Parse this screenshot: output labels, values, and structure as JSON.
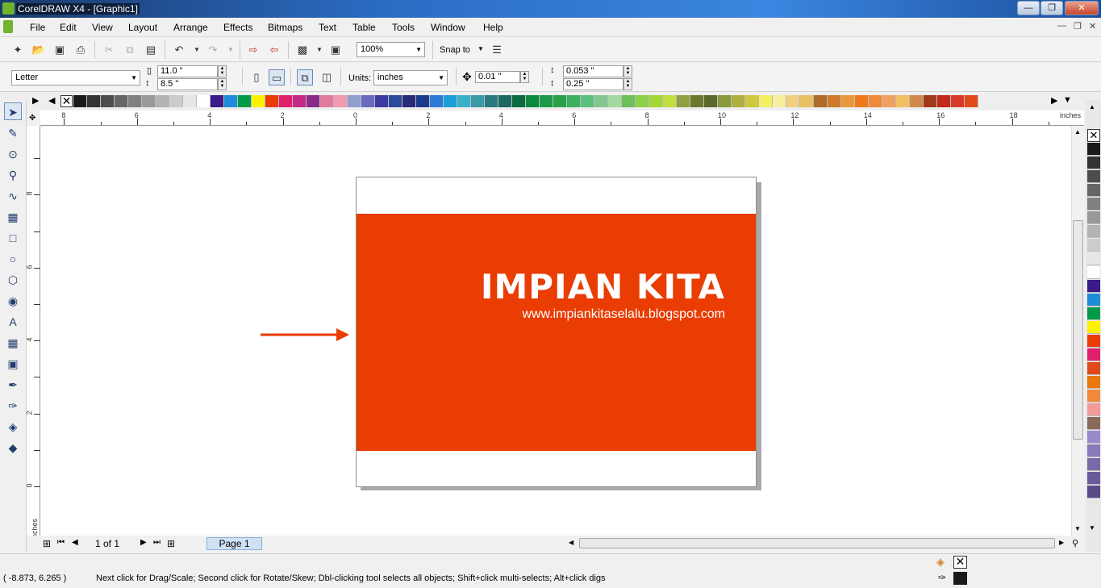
{
  "window": {
    "title": "CorelDRAW X4 - [Graphic1]"
  },
  "menu": [
    "File",
    "Edit",
    "View",
    "Layout",
    "Arrange",
    "Effects",
    "Bitmaps",
    "Text",
    "Table",
    "Tools",
    "Window",
    "Help"
  ],
  "toolbar": {
    "zoom": "100%",
    "snap_to": "Snap to"
  },
  "property_bar": {
    "paper_size": "Letter",
    "width": "11.0 \"",
    "height": "8.5 \"",
    "units_label": "Units:",
    "units": "inches",
    "nudge": "0.01 \"",
    "dup_x": "0.053 \"",
    "dup_y": "0.25 \""
  },
  "ruler": {
    "unit": "inches",
    "h_labels": [
      "8",
      "6",
      "4",
      "2",
      "0",
      "2",
      "4",
      "6",
      "8",
      "10",
      "12",
      "14",
      "16",
      "18"
    ],
    "v_labels": [
      "8",
      "6",
      "4",
      "2",
      "0"
    ],
    "v_unit": "inches"
  },
  "artwork": {
    "heading": "IMPIAN KITA",
    "url": "www.impiankitaselalu.blogspot.com",
    "banner_color": "#e93d04",
    "arrow_color": "#e93d04"
  },
  "page_nav": {
    "counter": "1 of 1",
    "tab": "Page 1"
  },
  "status": {
    "coords": "( -8.873, 6.265  )",
    "message": "Next click for Drag/Scale; Second click for Rotate/Skew; Dbl-clicking tool selects all objects; Shift+click multi-selects; Alt+click digs"
  },
  "palette_colors": [
    "#1a1a1a",
    "#333333",
    "#4d4d4d",
    "#666666",
    "#808080",
    "#999999",
    "#b3b3b3",
    "#cccccc",
    "#e6e6e6",
    "#ffffff",
    "#3b1a8a",
    "#1e8cd8",
    "#009a4a",
    "#fff200",
    "#e93d04",
    "#e0206a",
    "#c42a86",
    "#8c2a8c",
    "#e07aa0",
    "#f29ab0",
    "#8fa0d0",
    "#6a6ac0",
    "#3a3aa0",
    "#2a4a9a",
    "#2a2a7a",
    "#1a3a8a",
    "#2a7ad8",
    "#1aa0d8",
    "#3ab0c8",
    "#3a9aa8",
    "#2a7a80",
    "#1a6a60",
    "#0a6a40",
    "#0a8a40",
    "#1a9a4a",
    "#2aa04a",
    "#3ab060",
    "#5ac080",
    "#80c890",
    "#a0d8a0",
    "#6ac05a",
    "#8ad04a",
    "#a0d83a",
    "#c0e040",
    "#90a040",
    "#6a7a2a",
    "#5a6a2a",
    "#8a9a3a",
    "#b0b040",
    "#d0c840",
    "#f0f060",
    "#f8f0a0",
    "#f0d080",
    "#e8c060",
    "#b06a2a",
    "#d07a2a",
    "#e89a3a",
    "#f07a1a",
    "#f08a3a",
    "#f0a060",
    "#f0c060",
    "#d08a4a",
    "#a03a1a",
    "#c02a1a",
    "#d83a2a",
    "#e04a1a"
  ],
  "side_colors": [
    "#1a1a1a",
    "#333333",
    "#4d4d4d",
    "#666666",
    "#808080",
    "#999999",
    "#b3b3b3",
    "#cccccc",
    "#e6e6e6",
    "#ffffff",
    "#3b1a8a",
    "#1e8cd8",
    "#009a4a",
    "#fff200",
    "#e93d04",
    "#e0206a",
    "#e04a1a",
    "#e9780a",
    "#f08a3a",
    "#f29a9a",
    "#8a6a5a",
    "#9a8ac8",
    "#8a7ab8",
    "#7a6aa8",
    "#6a5a98",
    "#5a4a88"
  ],
  "status_fill": {
    "outline": "none",
    "fill": "#1a1a1a"
  }
}
